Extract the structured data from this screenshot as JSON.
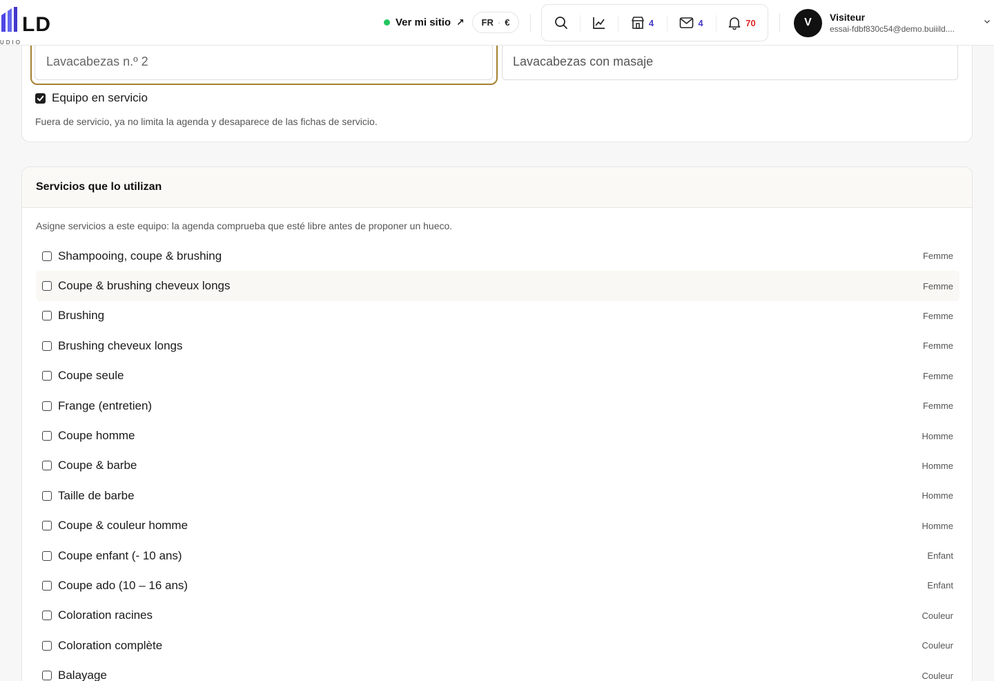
{
  "header": {
    "logo_text": "LD",
    "logo_subtext": "UDIO",
    "visit_site_label": "Ver mi sitio",
    "visit_site_arrow": "↗",
    "lang": "FR",
    "currency": "€",
    "tools": [
      {
        "name": "search",
        "icon": "search-icon"
      },
      {
        "name": "stats",
        "icon": "chart-line-icon"
      },
      {
        "name": "store",
        "icon": "store-icon",
        "count": "4"
      },
      {
        "name": "messages",
        "icon": "mail-icon",
        "count": "4"
      },
      {
        "name": "notifications",
        "icon": "bell-icon",
        "count": "70"
      }
    ],
    "user": {
      "initial": "V",
      "name": "Visiteur",
      "email": "essai-fdbf830c54@demo.buiiild...."
    }
  },
  "equipment": {
    "name_value": "Lavacabezas n.º 2",
    "description_placeholder": "Lavacabezas con masaje",
    "in_service_label": "Equipo en servicio",
    "in_service_checked": true,
    "help_text": "Fuera de servicio, ya no limita la agenda y desaparece de las fichas de servicio."
  },
  "services_section": {
    "title": "Servicios que lo utilizan",
    "help_text": "Asigne servicios a este equipo: la agenda comprueba que esté libre antes de proponer un hueco.",
    "items": [
      {
        "name": "Shampooing, coupe & brushing",
        "category": "Femme",
        "checked": false
      },
      {
        "name": "Coupe & brushing cheveux longs",
        "category": "Femme",
        "checked": false
      },
      {
        "name": "Brushing",
        "category": "Femme",
        "checked": false
      },
      {
        "name": "Brushing cheveux longs",
        "category": "Femme",
        "checked": false
      },
      {
        "name": "Coupe seule",
        "category": "Femme",
        "checked": false
      },
      {
        "name": "Frange (entretien)",
        "category": "Femme",
        "checked": false
      },
      {
        "name": "Coupe homme",
        "category": "Homme",
        "checked": false
      },
      {
        "name": "Coupe & barbe",
        "category": "Homme",
        "checked": false
      },
      {
        "name": "Taille de barbe",
        "category": "Homme",
        "checked": false
      },
      {
        "name": "Coupe & couleur homme",
        "category": "Homme",
        "checked": false
      },
      {
        "name": "Coupe enfant (- 10 ans)",
        "category": "Enfant",
        "checked": false
      },
      {
        "name": "Coupe ado (10 – 16 ans)",
        "category": "Enfant",
        "checked": false
      },
      {
        "name": "Coloration racines",
        "category": "Couleur",
        "checked": false
      },
      {
        "name": "Coloration complète",
        "category": "Couleur",
        "checked": false
      },
      {
        "name": "Balayage",
        "category": "Couleur",
        "checked": false
      }
    ]
  },
  "colors": {
    "accent_focus": "#a68030",
    "status_online": "#22c55e",
    "count_blue": "#4338ca",
    "count_red": "#dc2626"
  }
}
